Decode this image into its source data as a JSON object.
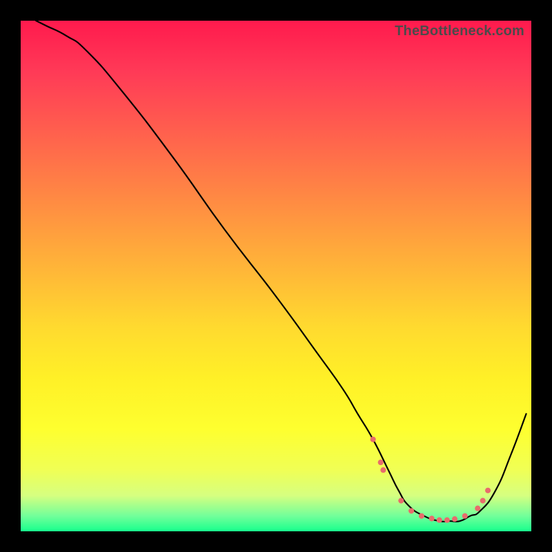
{
  "watermark": "TheBottleneck.com",
  "chart_data": {
    "type": "line",
    "title": "",
    "xlabel": "",
    "ylabel": "",
    "x_range": [
      0,
      100
    ],
    "y_range": [
      0,
      100
    ],
    "grid": false,
    "legend": false,
    "background": "gradient-red-yellow-green",
    "series": [
      {
        "name": "bottleneck-curve",
        "x": [
          3,
          5,
          9,
          13,
          20,
          30,
          40,
          50,
          58,
          63,
          66,
          69,
          72,
          74,
          76,
          79,
          82,
          84,
          86,
          88,
          90,
          93,
          96,
          99
        ],
        "y": [
          100,
          99,
          97,
          94,
          86,
          73,
          59,
          46,
          35,
          28,
          23,
          18,
          12,
          8,
          5,
          3,
          2,
          2,
          2,
          3,
          4,
          8,
          15,
          23
        ]
      }
    ],
    "markers": {
      "name": "highlight-dots",
      "color": "#e86c6c",
      "points": [
        {
          "x": 69.0,
          "y": 18.0
        },
        {
          "x": 70.5,
          "y": 13.5
        },
        {
          "x": 71.0,
          "y": 12.0
        },
        {
          "x": 74.5,
          "y": 6.0
        },
        {
          "x": 76.5,
          "y": 4.0
        },
        {
          "x": 78.5,
          "y": 3.0
        },
        {
          "x": 80.5,
          "y": 2.5
        },
        {
          "x": 82.0,
          "y": 2.2
        },
        {
          "x": 83.5,
          "y": 2.2
        },
        {
          "x": 85.0,
          "y": 2.4
        },
        {
          "x": 87.0,
          "y": 3.0
        },
        {
          "x": 89.5,
          "y": 4.5
        },
        {
          "x": 90.5,
          "y": 6.0
        },
        {
          "x": 91.5,
          "y": 8.0
        }
      ]
    }
  }
}
